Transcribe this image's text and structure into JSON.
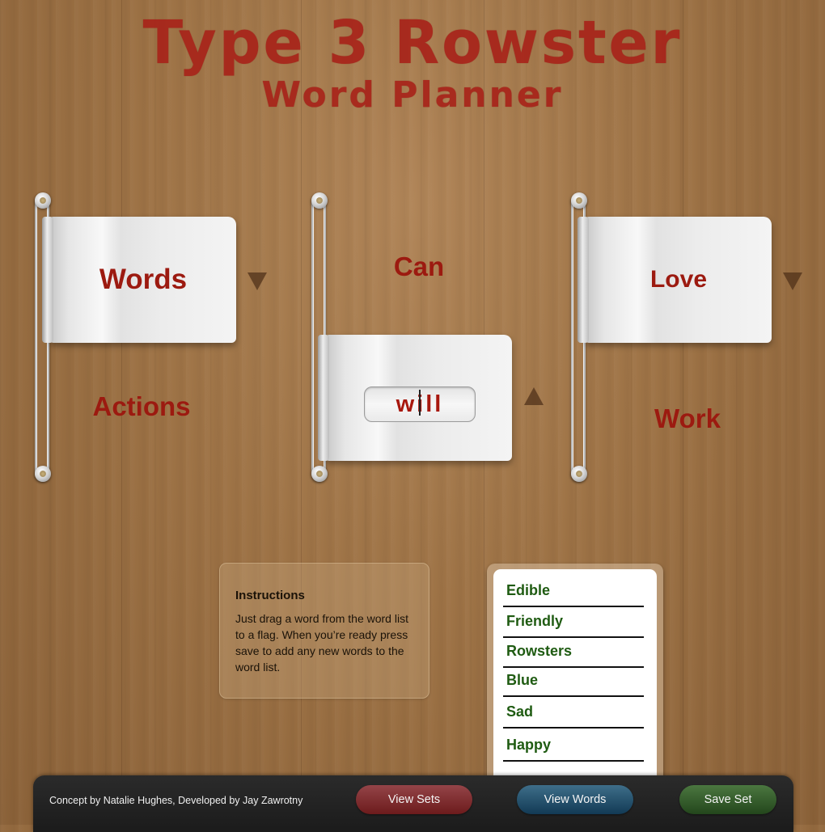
{
  "header": {
    "title": "Type 3 Rowster",
    "subtitle": "Word Planner"
  },
  "flags": [
    {
      "flag_word": "Words",
      "below_word": "Actions",
      "arrow": "down",
      "position": "top"
    },
    {
      "above_word": "Can",
      "flag_word": "will",
      "editing": true,
      "arrow": "up",
      "position": "bottom"
    },
    {
      "flag_word": "Love",
      "below_word": "Work",
      "arrow": "down",
      "position": "top"
    }
  ],
  "instructions": {
    "title": "Instructions",
    "body": "Just drag a word from the word list to a flag. When you’re ready press save to add any new words to the word list."
  },
  "word_list": {
    "items": [
      "Edible",
      "Friendly",
      "Rowsters",
      "Blue",
      "Sad",
      "Happy"
    ]
  },
  "toolbar": {
    "credits": "Concept by Natalie Hughes, Developed by Jay Zawrotny",
    "view_sets_label": "View Sets",
    "view_words_label": "View Words",
    "save_set_label": "Save Set"
  },
  "colors": {
    "accent_red": "#9c1a10",
    "word_green": "#1f5b12",
    "view_sets": "#7a2a2c",
    "view_words": "#28536e",
    "save_set": "#365e2e"
  }
}
